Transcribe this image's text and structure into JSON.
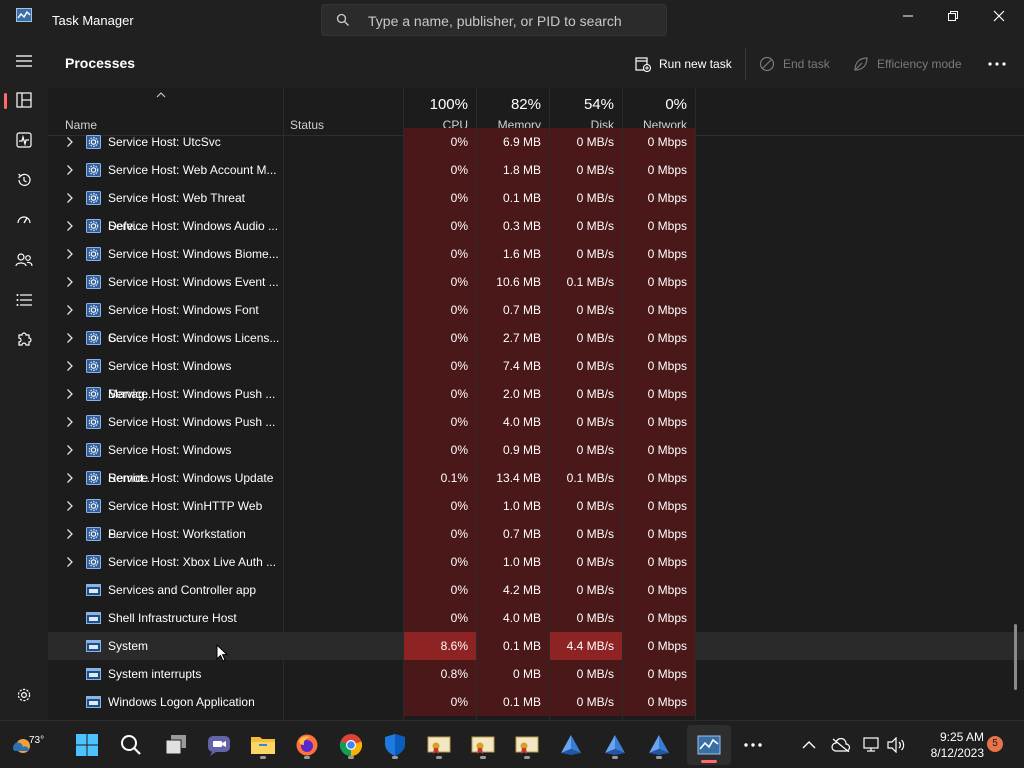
{
  "window": {
    "title": "Task Manager"
  },
  "search": {
    "placeholder": "Type a name, publisher, or PID to search"
  },
  "toolbar": {
    "page_title": "Processes",
    "run_new_task": "Run new task",
    "end_task": "End task",
    "efficiency_mode": "Efficiency mode"
  },
  "columns": {
    "name": "Name",
    "status": "Status",
    "cpu": {
      "pct": "100%",
      "label": "CPU"
    },
    "memory": {
      "pct": "82%",
      "label": "Memory"
    },
    "disk": {
      "pct": "54%",
      "label": "Disk"
    },
    "network": {
      "pct": "0%",
      "label": "Network"
    }
  },
  "processes": [
    {
      "name": "Service Host: UtcSvc",
      "expandable": true,
      "icon": "gear-icon",
      "cpu": "0%",
      "memory": "6.9 MB",
      "disk": "0 MB/s",
      "network": "0 Mbps"
    },
    {
      "name": "Service Host: Web Account M...",
      "expandable": true,
      "icon": "gear-icon",
      "cpu": "0%",
      "memory": "1.8 MB",
      "disk": "0 MB/s",
      "network": "0 Mbps"
    },
    {
      "name": "Service Host: Web Threat Defe...",
      "expandable": true,
      "icon": "gear-icon",
      "cpu": "0%",
      "memory": "0.1 MB",
      "disk": "0 MB/s",
      "network": "0 Mbps"
    },
    {
      "name": "Service Host: Windows Audio ...",
      "expandable": true,
      "icon": "gear-icon",
      "cpu": "0%",
      "memory": "0.3 MB",
      "disk": "0 MB/s",
      "network": "0 Mbps"
    },
    {
      "name": "Service Host: Windows Biome...",
      "expandable": true,
      "icon": "gear-icon",
      "cpu": "0%",
      "memory": "1.6 MB",
      "disk": "0 MB/s",
      "network": "0 Mbps"
    },
    {
      "name": "Service Host: Windows Event ...",
      "expandable": true,
      "icon": "gear-icon",
      "cpu": "0%",
      "memory": "10.6 MB",
      "disk": "0.1 MB/s",
      "network": "0 Mbps"
    },
    {
      "name": "Service Host: Windows Font C...",
      "expandable": true,
      "icon": "gear-icon",
      "cpu": "0%",
      "memory": "0.7 MB",
      "disk": "0 MB/s",
      "network": "0 Mbps"
    },
    {
      "name": "Service Host: Windows Licens...",
      "expandable": true,
      "icon": "gear-icon",
      "cpu": "0%",
      "memory": "2.7 MB",
      "disk": "0 MB/s",
      "network": "0 Mbps"
    },
    {
      "name": "Service Host: Windows Manag...",
      "expandable": true,
      "icon": "gear-icon",
      "cpu": "0%",
      "memory": "7.4 MB",
      "disk": "0 MB/s",
      "network": "0 Mbps"
    },
    {
      "name": "Service Host: Windows Push ...",
      "expandable": true,
      "icon": "gear-icon",
      "cpu": "0%",
      "memory": "2.0 MB",
      "disk": "0 MB/s",
      "network": "0 Mbps"
    },
    {
      "name": "Service Host: Windows Push ...",
      "expandable": true,
      "icon": "gear-icon",
      "cpu": "0%",
      "memory": "4.0 MB",
      "disk": "0 MB/s",
      "network": "0 Mbps"
    },
    {
      "name": "Service Host: Windows Remot...",
      "expandable": true,
      "icon": "gear-icon",
      "cpu": "0%",
      "memory": "0.9 MB",
      "disk": "0 MB/s",
      "network": "0 Mbps"
    },
    {
      "name": "Service Host: Windows Update",
      "expandable": true,
      "icon": "gear-icon",
      "cpu": "0.1%",
      "memory": "13.4 MB",
      "disk": "0.1 MB/s",
      "network": "0 Mbps"
    },
    {
      "name": "Service Host: WinHTTP Web P...",
      "expandable": true,
      "icon": "gear-icon",
      "cpu": "0%",
      "memory": "1.0 MB",
      "disk": "0 MB/s",
      "network": "0 Mbps"
    },
    {
      "name": "Service Host: Workstation",
      "expandable": true,
      "icon": "gear-icon",
      "cpu": "0%",
      "memory": "0.7 MB",
      "disk": "0 MB/s",
      "network": "0 Mbps"
    },
    {
      "name": "Service Host: Xbox Live Auth ...",
      "expandable": true,
      "icon": "gear-icon",
      "cpu": "0%",
      "memory": "1.0 MB",
      "disk": "0 MB/s",
      "network": "0 Mbps"
    },
    {
      "name": "Services and Controller app",
      "expandable": false,
      "icon": "window-icon",
      "cpu": "0%",
      "memory": "4.2 MB",
      "disk": "0 MB/s",
      "network": "0 Mbps"
    },
    {
      "name": "Shell Infrastructure Host",
      "expandable": false,
      "icon": "window-icon",
      "cpu": "0%",
      "memory": "4.0 MB",
      "disk": "0 MB/s",
      "network": "0 Mbps"
    },
    {
      "name": "System",
      "expandable": false,
      "icon": "window-icon",
      "cpu": "8.6%",
      "memory": "0.1 MB",
      "disk": "4.4 MB/s",
      "network": "0 Mbps",
      "hovered": true
    },
    {
      "name": "System interrupts",
      "expandable": false,
      "icon": "window-icon",
      "cpu": "0.8%",
      "memory": "0 MB",
      "disk": "0 MB/s",
      "network": "0 Mbps"
    },
    {
      "name": "Windows Logon Application",
      "expandable": false,
      "icon": "window-icon",
      "cpu": "0%",
      "memory": "0.1 MB",
      "disk": "0 MB/s",
      "network": "0 Mbps"
    }
  ],
  "sidebar": {
    "items": [
      {
        "name": "sidebar-item-menu",
        "icon": "hamburger-icon"
      },
      {
        "name": "sidebar-item-processes",
        "icon": "processes-icon",
        "active": true
      },
      {
        "name": "sidebar-item-performance",
        "icon": "performance-icon"
      },
      {
        "name": "sidebar-item-app-history",
        "icon": "history-icon"
      },
      {
        "name": "sidebar-item-startup-apps",
        "icon": "speedometer-icon"
      },
      {
        "name": "sidebar-item-users",
        "icon": "users-icon"
      },
      {
        "name": "sidebar-item-details",
        "icon": "list-icon"
      },
      {
        "name": "sidebar-item-services",
        "icon": "puzzle-icon"
      },
      {
        "name": "sidebar-item-settings",
        "icon": "gear-icon"
      }
    ]
  },
  "taskbar": {
    "weather_temp": "73°",
    "time": "9:25 AM",
    "date": "8/12/2023",
    "notification_count": "5"
  },
  "colors": {
    "heat_low": "#4a1818",
    "heat_high": "#7a1f1f",
    "accent": "#ff6b6b"
  }
}
